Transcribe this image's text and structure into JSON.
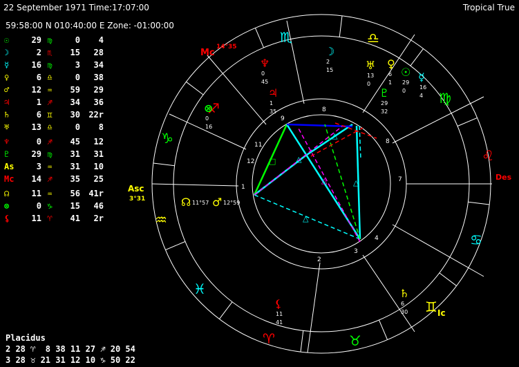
{
  "header": {
    "date": "22 September 1971",
    "time": "Time:17:07:00",
    "system": "Tropical True",
    "location": "59:58:00 N 010:40:00 E",
    "zone": "Zone: -01:00:00"
  },
  "positions": [
    {
      "body": "sun",
      "glyph": "☉",
      "color": "#00ff00",
      "deg": "29",
      "sign": "♍",
      "sign_color": "#00ff00",
      "min": "0",
      "sec": "4"
    },
    {
      "body": "moon",
      "glyph": "☽",
      "color": "#00ffff",
      "deg": "2",
      "sign": "♏",
      "sign_color": "#ff0000",
      "min": "15",
      "sec": "28"
    },
    {
      "body": "mercury",
      "glyph": "☿",
      "color": "#00ffff",
      "deg": "16",
      "sign": "♍",
      "sign_color": "#00ff00",
      "min": "3",
      "sec": "34"
    },
    {
      "body": "venus",
      "glyph": "♀",
      "color": "#ffff00",
      "deg": "6",
      "sign": "♎",
      "sign_color": "#ffff00",
      "min": "0",
      "sec": "38"
    },
    {
      "body": "mars",
      "glyph": "♂",
      "color": "#ffff00",
      "deg": "12",
      "sign": "♒",
      "sign_color": "#ffff00",
      "min": "59",
      "sec": "29"
    },
    {
      "body": "jupiter",
      "glyph": "♃",
      "color": "#ff0000",
      "deg": "1",
      "sign": "♐",
      "sign_color": "#ff0000",
      "min": "34",
      "sec": "36"
    },
    {
      "body": "saturn",
      "glyph": "♄",
      "color": "#ffff00",
      "deg": "6",
      "sign": "♊",
      "sign_color": "#ffff00",
      "min": "30",
      "sec": "22r"
    },
    {
      "body": "uranus",
      "glyph": "♅",
      "color": "#ffff00",
      "deg": "13",
      "sign": "♎",
      "sign_color": "#ffff00",
      "min": "0",
      "sec": "8"
    },
    {
      "body": "neptune",
      "glyph": "♆",
      "color": "#ff0000",
      "deg": "0",
      "sign": "♐",
      "sign_color": "#ff0000",
      "min": "45",
      "sec": "12"
    },
    {
      "body": "pluto",
      "glyph": "♇",
      "color": "#00ff00",
      "deg": "29",
      "sign": "♍",
      "sign_color": "#00ff00",
      "min": "31",
      "sec": "31"
    },
    {
      "body": "ascendant",
      "glyph": "As",
      "color": "#ffff00",
      "deg": "3",
      "sign": "♒",
      "sign_color": "#ffff00",
      "min": "31",
      "sec": "10"
    },
    {
      "body": "midheaven",
      "glyph": "Mc",
      "color": "#ff0000",
      "deg": "14",
      "sign": "♐",
      "sign_color": "#ff0000",
      "min": "35",
      "sec": "25"
    },
    {
      "body": "node",
      "glyph": "☊",
      "color": "#ffff00",
      "deg": "11",
      "sign": "♒",
      "sign_color": "#ffff00",
      "min": "56",
      "sec": "41r"
    },
    {
      "body": "fortune",
      "glyph": "⊗",
      "color": "#00ff00",
      "deg": "0",
      "sign": "♑",
      "sign_color": "#00ff00",
      "min": "15",
      "sec": "46"
    },
    {
      "body": "lilith",
      "glyph": "⚸",
      "color": "#ff0000",
      "deg": "11",
      "sign": "♈",
      "sign_color": "#ff0000",
      "min": "41",
      "sec": "2r"
    }
  ],
  "cusps": {
    "title": "Placidus",
    "line1": "2 28 ♈  8 38 11 27 ♐ 20 54",
    "line2": "3 28 ♉ 21 31 12 10 ♑ 50 22"
  },
  "wheel": {
    "asc_label": "Asc",
    "asc_deg": "3°31",
    "des_label": "Des",
    "mc_label": "Mc",
    "mc_deg": "14°35",
    "ic_label": "Ic",
    "house_numbers": [
      "1",
      "2",
      "3",
      "4",
      "5",
      "6",
      "7",
      "8",
      "9",
      "10",
      "11",
      "12"
    ],
    "zodiac": [
      {
        "glyph": "♒",
        "color": "#ffff00"
      },
      {
        "glyph": "♑",
        "color": "#00ff00"
      },
      {
        "glyph": "♐",
        "color": "#ff0000"
      },
      {
        "glyph": "♏",
        "color": "#00ffff"
      },
      {
        "glyph": "♎",
        "color": "#ffff00"
      },
      {
        "glyph": "♍",
        "color": "#00ff00"
      },
      {
        "glyph": "♌",
        "color": "#ff0000"
      },
      {
        "glyph": "♋",
        "color": "#00ffff"
      },
      {
        "glyph": "♊",
        "color": "#ffff00"
      },
      {
        "glyph": "♉",
        "color": "#00ff00"
      },
      {
        "glyph": "♈",
        "color": "#ff0000"
      },
      {
        "glyph": "♓",
        "color": "#00ffff"
      }
    ],
    "planet_labels": [
      {
        "glyph": "☽",
        "color": "#00ffff",
        "d": "2",
        "m": "15"
      },
      {
        "glyph": "♅",
        "color": "#ffff00",
        "d": "13",
        "m": "0"
      },
      {
        "glyph": "♀",
        "color": "#ffff00",
        "d": "6",
        "m": "1"
      },
      {
        "glyph": "☉",
        "color": "#00ff00",
        "d": "29",
        "m": "0"
      },
      {
        "glyph": "☿",
        "color": "#00ffff",
        "d": "16",
        "m": "4"
      },
      {
        "glyph": "♇",
        "color": "#00ff00",
        "d": "29",
        "m": "32"
      },
      {
        "glyph": "♆",
        "color": "#ff0000",
        "d": "0",
        "m": "45"
      },
      {
        "glyph": "♃",
        "color": "#ff0000",
        "d": "1",
        "m": "35"
      },
      {
        "glyph": "⊗",
        "color": "#00ff00",
        "d": "0",
        "m": "16"
      },
      {
        "glyph": "☊",
        "color": "#ffff00",
        "d": "11°57",
        "m": ""
      },
      {
        "glyph": "♂",
        "color": "#ffff00",
        "d": "12°59",
        "m": ""
      },
      {
        "glyph": "⚸",
        "color": "#ff0000",
        "d": "11",
        "m": "41"
      },
      {
        "glyph": "♄",
        "color": "#ffff00",
        "d": "6",
        "m": "30"
      }
    ],
    "aspect_glyphs": [
      "□",
      "△",
      "△",
      "△",
      "△",
      "△"
    ]
  }
}
